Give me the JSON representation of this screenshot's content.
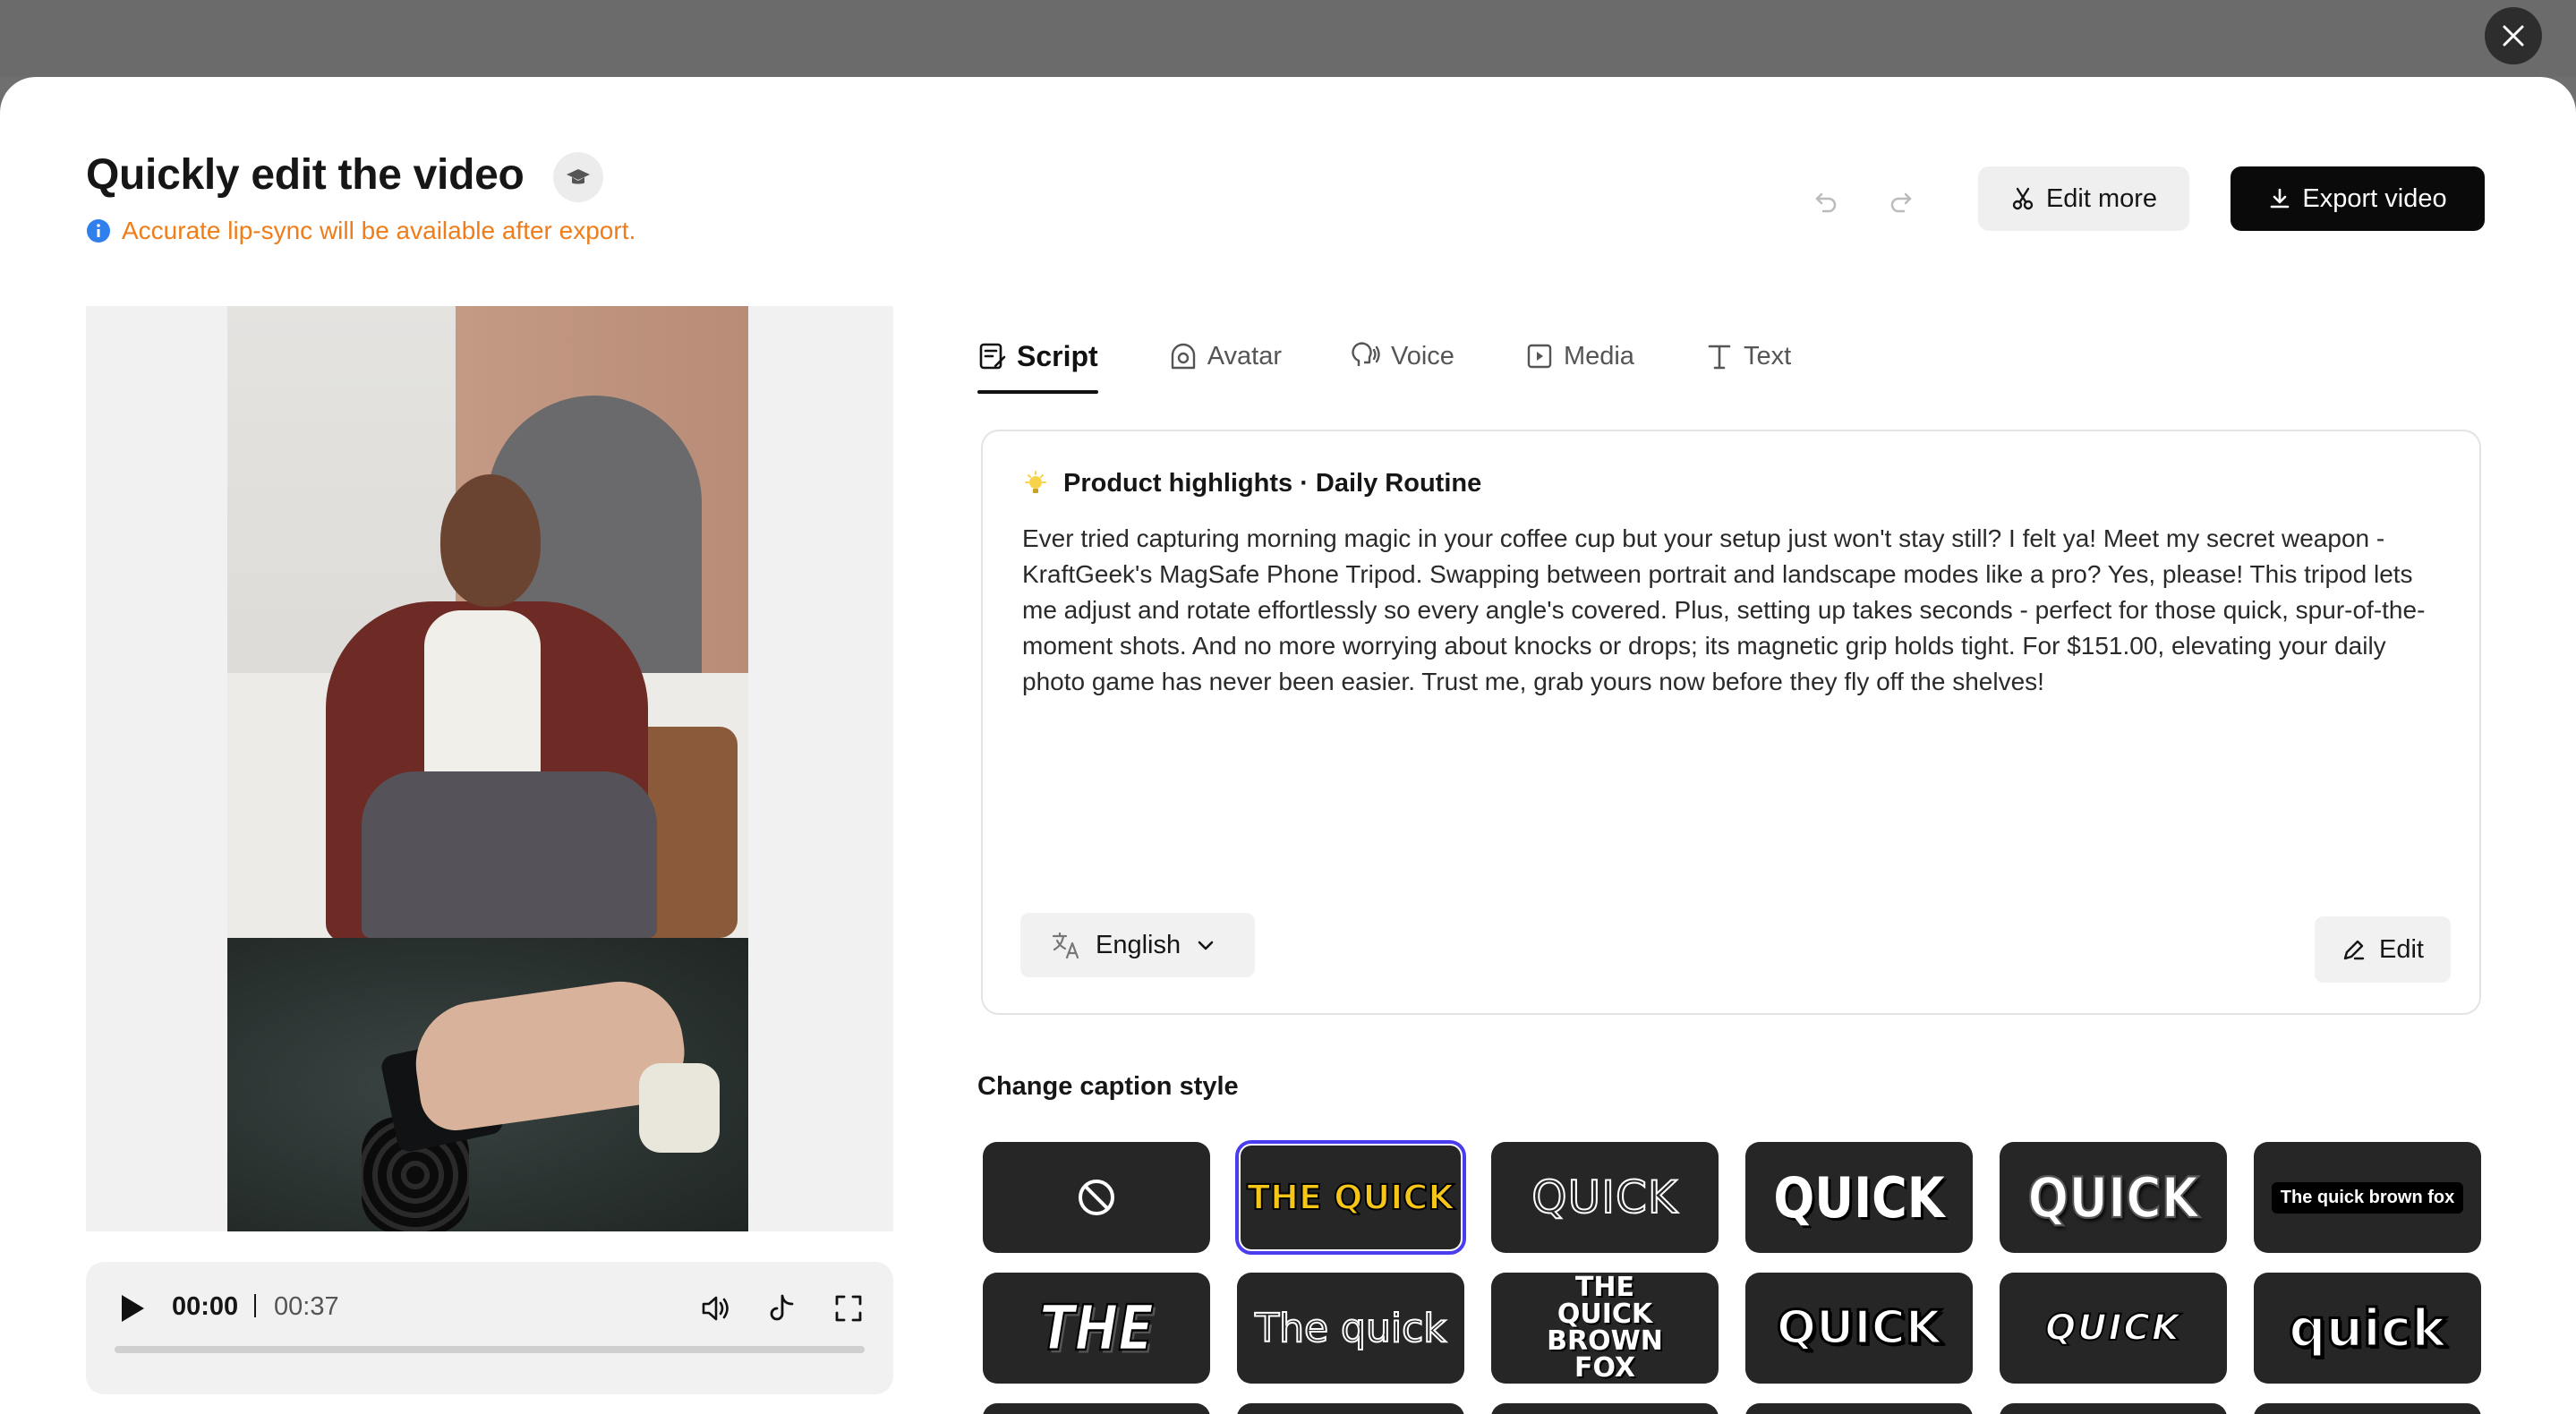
{
  "header": {
    "title": "Quickly edit the video",
    "notice": "Accurate lip-sync will be available after export.",
    "edit_more_label": "Edit more",
    "export_label": "Export video"
  },
  "player": {
    "current_time": "00:00",
    "total_time": "00:37",
    "progress": 0
  },
  "tabs": [
    {
      "label": "Script",
      "icon": "script-icon",
      "active": true
    },
    {
      "label": "Avatar",
      "icon": "avatar-icon",
      "active": false
    },
    {
      "label": "Voice",
      "icon": "voice-icon",
      "active": false
    },
    {
      "label": "Media",
      "icon": "media-icon",
      "active": false
    },
    {
      "label": "Text",
      "icon": "text-icon",
      "active": false
    }
  ],
  "script": {
    "heading": "Product highlights · Daily Routine",
    "body": "Ever tried capturing morning magic in your coffee cup but your setup just won't stay still? I felt ya! Meet my secret weapon - KraftGeek's MagSafe Phone Tripod. Swapping between portrait and landscape modes like a pro? Yes, please! This tripod lets me adjust and rotate effortlessly so every angle's covered. Plus, setting up takes seconds - perfect for those quick, spur-of-the-moment shots. And no more worrying about knocks or drops; its magnetic grip holds tight. For $151.00, elevating your daily photo game has never been easier. Trust me, grab yours now before they fly off the shelves!",
    "language": "English",
    "edit_label": "Edit"
  },
  "captions": {
    "title": "Change caption style",
    "styles": [
      {
        "label": "",
        "icon": "none-icon"
      },
      {
        "label": "THE QUICK",
        "selected": true
      },
      {
        "label": "QUICK"
      },
      {
        "label": "QUICK"
      },
      {
        "label": "QUICK"
      },
      {
        "label": "The quick brown fox"
      },
      {
        "label": "THE"
      },
      {
        "label": "The quick"
      },
      {
        "label": "THE QUICK BROWN FOX"
      },
      {
        "label": "QUICK"
      },
      {
        "label": "QUICK"
      },
      {
        "label": "quick"
      }
    ]
  },
  "colors": {
    "accent_selected": "#4a3df0",
    "notice": "#ee7d1a",
    "info_icon": "#2f80ed",
    "caption_yellow": "#f5c518",
    "caption_green": "#7ed321"
  }
}
